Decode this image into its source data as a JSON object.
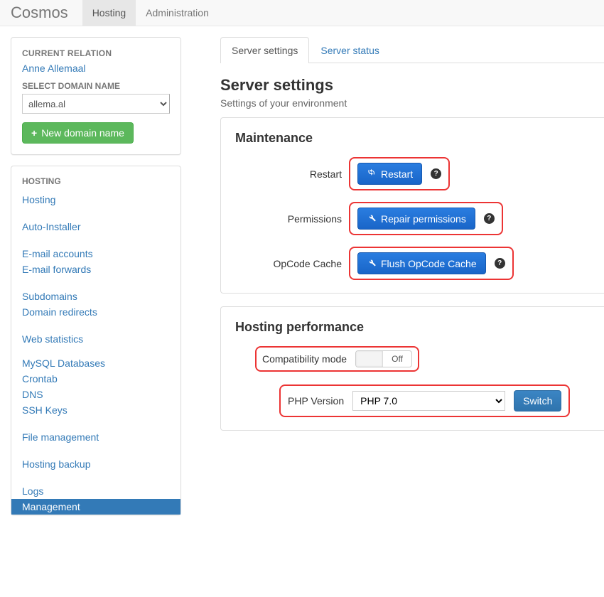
{
  "brand": "Cosmos",
  "topnav": {
    "hosting": "Hosting",
    "administration": "Administration"
  },
  "sidebar": {
    "currentRelationLabel": "CURRENT RELATION",
    "currentRelationName": "Anne Allemaal",
    "selectDomainLabel": "SELECT DOMAIN NAME",
    "domainSelected": "allema.al",
    "newDomainLabel": "New domain name",
    "hostingHeading": "HOSTING",
    "items": [
      "Hosting",
      "Auto-Installer",
      "E-mail accounts",
      "E-mail forwards",
      "Subdomains",
      "Domain redirects",
      "Web statistics",
      "MySQL Databases",
      "Crontab",
      "DNS",
      "SSH Keys",
      "File management",
      "Hosting backup",
      "Logs",
      "Management"
    ]
  },
  "tabs": {
    "settings": "Server settings",
    "status": "Server status"
  },
  "page": {
    "title": "Server settings",
    "subtitle": "Settings of your environment"
  },
  "maint": {
    "title": "Maintenance",
    "restartLabel": "Restart",
    "restartBtn": "Restart",
    "permissionsLabel": "Permissions",
    "repairBtn": "Repair permissions",
    "opcodeLabel": "OpCode Cache",
    "flushBtn": "Flush OpCode Cache"
  },
  "perf": {
    "title": "Hosting performance",
    "compatLabel": "Compatibility mode",
    "compatState": "Off",
    "phpLabel": "PHP Version",
    "phpSelected": "PHP 7.0",
    "switchBtn": "Switch"
  }
}
